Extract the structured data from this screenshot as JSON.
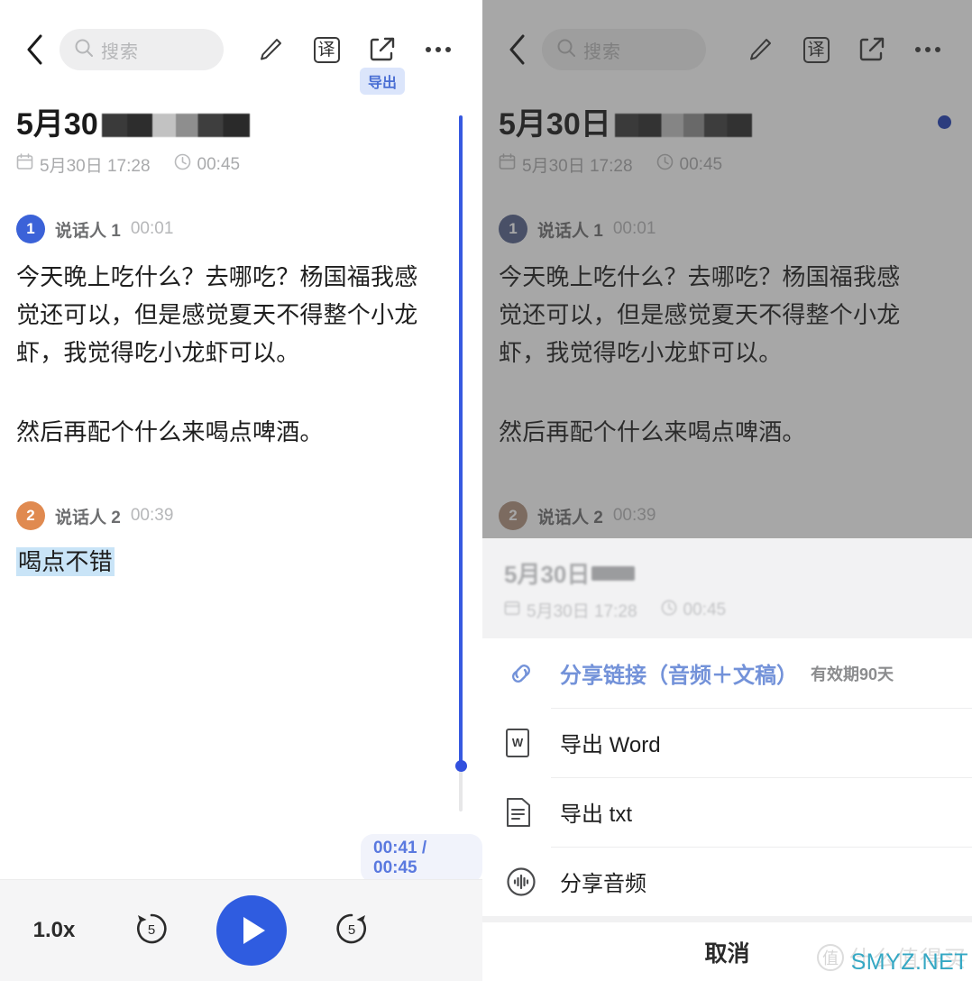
{
  "topbar": {
    "back_icon": "chevron-left-icon",
    "search_placeholder": "搜索",
    "search_icon": "search-icon",
    "edit_icon": "pencil-icon",
    "translate_label": "译",
    "export_icon": "export-share-icon",
    "export_tooltip": "导出",
    "more_icon": "more-dots-icon"
  },
  "document": {
    "title_prefix": "5月30",
    "title_prefix_right": "5月30日",
    "calendar_icon": "calendar-icon",
    "date": "5月30日 17:28",
    "clock_icon": "clock-icon",
    "duration": "00:45"
  },
  "transcript": {
    "segments": [
      {
        "speaker_number": "1",
        "speaker_name": "说话人 1",
        "time": "00:01",
        "color": "#3b62d8",
        "paragraphs": [
          "今天晚上吃什么？去哪吃？杨国福我感觉还可以，但是感觉夏天不得整个小龙虾，我觉得吃小龙虾可以。",
          "然后再配个什么来喝点啤酒。"
        ]
      },
      {
        "speaker_number": "2",
        "speaker_name": "说话人 2",
        "time": "00:39",
        "color": "#e08a50",
        "paragraphs": [
          "喝点不错"
        ],
        "highlight": true
      }
    ]
  },
  "playback": {
    "time_badge": "00:41 / 00:45",
    "speed": "1.0x",
    "rewind_label": "5",
    "forward_label": "5",
    "rewind_icon": "rewind-5-icon",
    "forward_icon": "forward-5-icon",
    "play_icon": "play-icon",
    "accent_color": "#2f5ce0"
  },
  "sheet": {
    "header_title": "5月30日",
    "header_date": "5月30日 17:28",
    "header_duration": "00:45",
    "rows": [
      {
        "icon": "link-icon",
        "label": "分享链接（音频＋文稿）",
        "sub": "有效期90天",
        "is_link": true
      },
      {
        "icon": "word-doc-icon",
        "label": "导出 Word",
        "sub": ""
      },
      {
        "icon": "txt-doc-icon",
        "label": "导出 txt",
        "sub": ""
      },
      {
        "icon": "audio-wave-icon",
        "label": "分享音频",
        "sub": ""
      }
    ],
    "cancel_label": "取消"
  },
  "watermark": {
    "badge": "值",
    "text": "什么值得买",
    "site": "SMYZ.NET"
  }
}
